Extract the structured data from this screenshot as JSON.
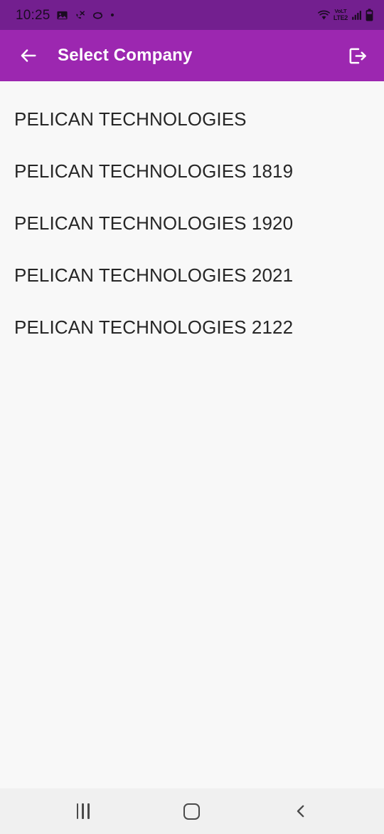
{
  "status_bar": {
    "clock": "10:25",
    "left_icons": [
      "image-icon",
      "missed-call-icon",
      "link-icon",
      "dot-icon"
    ],
    "right_icons": [
      "wifi-icon",
      "volte-icon",
      "signal-icon",
      "battery-icon"
    ],
    "volte_top": "VoLT",
    "volte_bottom": "LTE2",
    "background_color": "#731f8f"
  },
  "app_bar": {
    "title": "Select Company",
    "back_icon": "arrow-left-icon",
    "logout_icon": "logout-icon",
    "background_color": "#9c27b0",
    "text_color": "#ffffff"
  },
  "company_list": {
    "items": [
      {
        "name": "PELICAN TECHNOLOGIES"
      },
      {
        "name": "PELICAN TECHNOLOGIES 1819"
      },
      {
        "name": "PELICAN TECHNOLOGIES 1920"
      },
      {
        "name": "PELICAN TECHNOLOGIES 2021"
      },
      {
        "name": "PELICAN TECHNOLOGIES 2122"
      }
    ],
    "background_color": "#f8f8f8",
    "text_color": "#262626"
  },
  "nav_bar": {
    "recents_icon": "recents-icon",
    "home_icon": "home-icon",
    "back_icon": "chevron-left-icon",
    "background_color": "#f0f0f0"
  }
}
